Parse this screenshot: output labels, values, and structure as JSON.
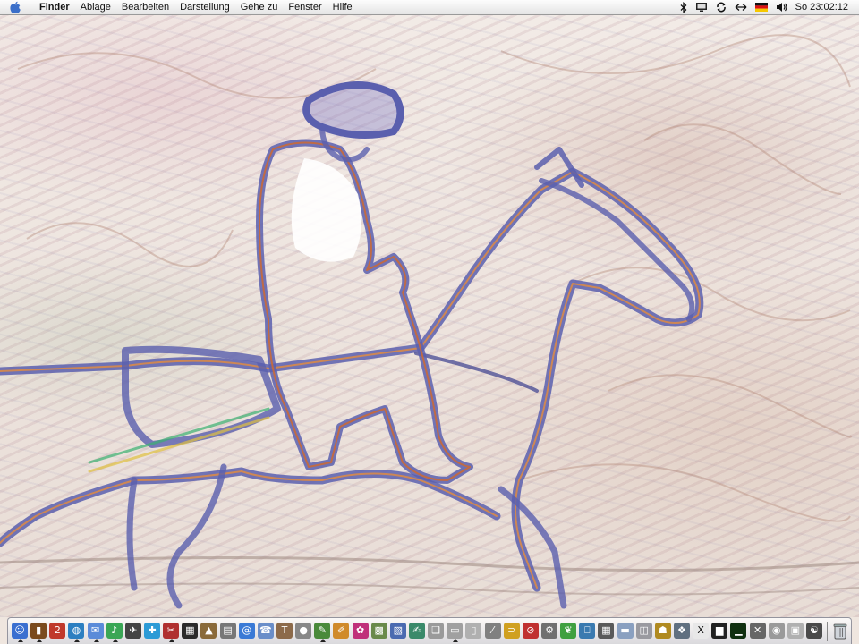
{
  "menubar": {
    "apple_icon": "apple-icon",
    "items": [
      "Finder",
      "Ablage",
      "Bearbeiten",
      "Darstellung",
      "Gehe zu",
      "Fenster",
      "Hilfe"
    ],
    "extras": [
      "bluetooth-icon",
      "display-icon",
      "sync-icon",
      "network-icon",
      "flag-germany-icon",
      "volume-icon"
    ],
    "clock": "So 23:02:12"
  },
  "dock": {
    "apps": [
      {
        "icon": "finder-icon",
        "color": "#3a6fd0",
        "glyph": "☺",
        "running": true
      },
      {
        "icon": "book-icon",
        "color": "#7a4a1c",
        "glyph": "▮",
        "running": true
      },
      {
        "icon": "calendar-icon",
        "color": "#c0392b",
        "glyph": "2",
        "running": false
      },
      {
        "icon": "globe-icon",
        "color": "#2c7fc1",
        "glyph": "◍",
        "running": true
      },
      {
        "icon": "mail-icon",
        "color": "#5b8bd9",
        "glyph": "✉",
        "running": true
      },
      {
        "icon": "music-icon",
        "color": "#3aa655",
        "glyph": "♪",
        "running": true
      },
      {
        "icon": "tools-icon",
        "color": "#444444",
        "glyph": "✈",
        "running": false
      },
      {
        "icon": "drop-icon",
        "color": "#2d9bd6",
        "glyph": "✚",
        "running": false
      },
      {
        "icon": "scissors-icon",
        "color": "#b03030",
        "glyph": "✂",
        "running": true
      },
      {
        "icon": "film-icon",
        "color": "#2b2b2b",
        "glyph": "▦",
        "running": false
      },
      {
        "icon": "photo-icon",
        "color": "#8a6a3a",
        "glyph": "▲",
        "running": false
      },
      {
        "icon": "printer-icon",
        "color": "#777777",
        "glyph": "▤",
        "running": false
      },
      {
        "icon": "at-icon",
        "color": "#3a7ad6",
        "glyph": "@",
        "running": false
      },
      {
        "icon": "chat-icon",
        "color": "#6a8ec9",
        "glyph": "☎",
        "running": false
      },
      {
        "icon": "stamp-icon",
        "color": "#8c6a4a",
        "glyph": "T",
        "running": false
      },
      {
        "icon": "ball-icon",
        "color": "#888888",
        "glyph": "●",
        "running": false
      },
      {
        "icon": "pencil-icon",
        "color": "#4a8a3a",
        "glyph": "✎",
        "running": true
      },
      {
        "icon": "brush-icon",
        "color": "#d08a2a",
        "glyph": "✐",
        "running": false
      },
      {
        "icon": "flower-icon",
        "color": "#c0307a",
        "glyph": "✿",
        "running": false
      },
      {
        "icon": "puzzle-icon",
        "color": "#6a8a4a",
        "glyph": "▩",
        "running": false
      },
      {
        "icon": "chart-icon",
        "color": "#4a6ab0",
        "glyph": "▧",
        "running": false
      },
      {
        "icon": "note-icon",
        "color": "#3a8a6a",
        "glyph": "✍",
        "running": false
      },
      {
        "icon": "document-icon",
        "color": "#9a9a9a",
        "glyph": "❑",
        "running": false
      },
      {
        "icon": "paper-icon",
        "color": "#a0a0a0",
        "glyph": "▭",
        "running": true
      },
      {
        "icon": "clipboard-icon",
        "color": "#b0b0b0",
        "glyph": "▯",
        "running": false
      },
      {
        "icon": "feather-icon",
        "color": "#808080",
        "glyph": "⁄",
        "running": false
      },
      {
        "icon": "key-icon",
        "color": "#d0a020",
        "glyph": "⊃",
        "running": false
      },
      {
        "icon": "prohibited-icon",
        "color": "#c03030",
        "glyph": "⊘",
        "running": false
      },
      {
        "icon": "gear-icon",
        "color": "#707070",
        "glyph": "⚙",
        "running": false
      },
      {
        "icon": "leaf-icon",
        "color": "#40a040",
        "glyph": "❦",
        "running": false
      },
      {
        "icon": "books-icon",
        "color": "#3a7ab0",
        "glyph": "⎕",
        "running": false
      },
      {
        "icon": "calculator-icon",
        "color": "#5a5a5a",
        "glyph": "▦",
        "running": false
      },
      {
        "icon": "folder-icon",
        "color": "#8aa0c0",
        "glyph": "▬",
        "running": false
      },
      {
        "icon": "disk-icon",
        "color": "#9a9aa0",
        "glyph": "◫",
        "running": false
      },
      {
        "icon": "hat-icon",
        "color": "#b08a20",
        "glyph": "☗",
        "running": false
      },
      {
        "icon": "gears-icon",
        "color": "#607080",
        "glyph": "❖",
        "running": false
      },
      {
        "icon": "x11-icon",
        "color": "#e8e8e8",
        "glyph": "X",
        "running": false
      },
      {
        "icon": "terminal-icon",
        "color": "#222222",
        "glyph": "▆",
        "running": false
      },
      {
        "icon": "activity-monitor-icon",
        "color": "#103010",
        "glyph": "▁",
        "running": false
      },
      {
        "icon": "utility-icon",
        "color": "#666666",
        "glyph": "✕",
        "running": false
      },
      {
        "icon": "burn-icon",
        "color": "#9a9a9a",
        "glyph": "◉",
        "running": false
      },
      {
        "icon": "preview-icon",
        "color": "#b0b0b0",
        "glyph": "▣",
        "running": false
      },
      {
        "icon": "system-prefs-icon",
        "color": "#4a4a4a",
        "glyph": "☯",
        "running": false
      }
    ],
    "trash_icon": "trash-icon"
  }
}
